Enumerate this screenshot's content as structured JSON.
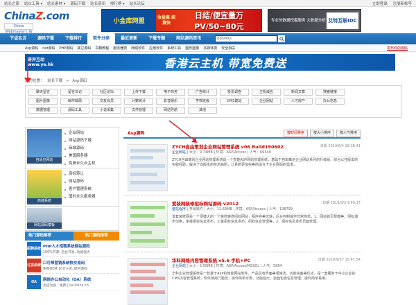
{
  "topbar": {
    "left": [
      "站长之家",
      "站长工具 ▾",
      "站长素材 ▾",
      "源码下载",
      "站长资讯",
      "排行榜 ▾",
      "站长论坛"
    ],
    "right": [
      "立即登录",
      "注册新帐号"
    ]
  },
  "header": {
    "logo_brand_a": "China",
    "logo_brand_z": "Z",
    "logo_brand_b": ".com",
    "logo_tag": "China Webmaster | 站长下载",
    "banner1_left": "小金库网盟",
    "banner1_mid": "收益高 结算快",
    "banner1_right": "日结/便宜量万PV/50~80元",
    "banner2_text": "专业的数据挖掘服务 大数据分析",
    "banner2_logo": "艾特互联IDC"
  },
  "nav": {
    "items": [
      {
        "label": "下载首页",
        "active": false
      },
      {
        "label": "源码下载",
        "active": false
      },
      {
        "label": "下载排行",
        "active": false
      },
      {
        "label": "软件分类",
        "active": true
      },
      {
        "label": "最近更新",
        "active": false
      },
      {
        "label": "下载专题",
        "active": false
      },
      {
        "label": "网站源码资讯",
        "active": false
      }
    ],
    "search_placeholder": "BBSMAX"
  },
  "subnav": {
    "items": [
      "Asp源码",
      "net源码",
      "PHP源码",
      "其它源码",
      "书籍教程",
      "服务器类",
      "网络软件",
      "应用软件",
      "系统工具",
      "图形图像",
      "多媒体类",
      "安全相关"
    ],
    "publish": "发布你的源码"
  },
  "bigbanner": {
    "brand": "奇异互动 www.ye.hk",
    "slogan": "香港云主机  带宽免费送"
  },
  "breadcrumb": [
    "您的位置：",
    "站长下载",
    ">",
    "Asp源码"
  ],
  "tags": [
    [
      "聊天留言",
      "留言日记",
      "社区论坛",
      "上传下载",
      "电子商务",
      "广告统计",
      "投票调查",
      "主机域名",
      "新闻文章",
      "搜索链接"
    ],
    [
      "图片图像",
      "邮件邮局",
      "交友会员",
      "计数统计",
      "影音娱乐",
      "学校班级",
      "CMS建站",
      "企业网站",
      "人才房产",
      "办公信息"
    ],
    [
      "数据管理",
      "源码工具",
      "小说采集",
      "文件管理",
      "网站导航",
      "其他"
    ]
  ],
  "left": {
    "sections": [
      {
        "caption": "自适应网站",
        "links": [
          "企业网站",
          "网站源码下载",
          "商城源码",
          "美国服务器",
          "免费永久云主机"
        ]
      },
      {
        "caption": "商城系统",
        "links": [
          "商标转让",
          "网站源码",
          "客户管理系统",
          "国外永久服务器"
        ]
      },
      {
        "caption": "网站源码模板",
        "links": []
      }
    ],
    "hot_tab": "热门源码推荐",
    "hot_tab2": "热门源码推荐",
    "hot_items": [
      {
        "icon": "招聘系统",
        "color": "#1b6fc0",
        "title": "PHP人才招聘系统网站源码",
        "desc": "100%开源, 后台开发, 功能强大"
      },
      {
        "icon": "订货系统",
        "color": "#d43a2a",
        "title": "口可帮营销系统快交易码",
        "desc": "免费OEM 10万+店, 提供源码"
      },
      {
        "icon": "OA",
        "color": "#1b6fc0",
        "title": "网络办公自动化（OA）系统",
        "desc": "无成功会 · 免费 | oa.ibilnu.cn"
      }
    ]
  },
  "right": {
    "section_title": "Asp源码",
    "sort_buttons": [
      {
        "label": "按时间排序",
        "on": true
      },
      {
        "label": "按大小排序",
        "on": false
      },
      {
        "label": "按人气排序",
        "on": false
      }
    ],
    "entries": [
      {
        "title": "ZYCH自由策划企业网站管理系统 v06 Build190602",
        "date": "日期 2019/6/4 18:38:41",
        "category": "企业网站",
        "meta": "| 大小：9.74MB | 环境：ASP/Access | 人气：69349",
        "desc": "ZYCH自由策划企业网站管理系统是一个智能ASP网站管理系统，基础于自由策划企业网站系列的升级版，综合以往版本的实践经验，解决了旧版本的技术缺陷，让系统更加完美的适合于企业网站的需求。"
      },
      {
        "title": "爱装网装修招标网站源码 v2012",
        "date": "日期 2019/9/3 9:49:17",
        "category": "整站程序",
        "meta": "| 开源软件 | 大小：11.63MB | 环境：ASP/Access | 人气：138799",
        "desc": "该套装修网是一个便捷大的一个装修装修招标网站，程序完美无缺，后台控制操作非常简单，1、网站首页规模等，招标城市切换，家装招标信息发布，工装招标信息发布，招标信息管理等，2、招标信息发布页面管理。"
      },
      {
        "title": "华科网络内容管理系统 v5.6 手机+PC",
        "date": "日期 2019/9/17 15:47:54",
        "category": "企业网站",
        "meta": "| 大小：5.95MB | 环境：ASP/Access/MSSQL | 人气：5884",
        "desc": "华科企业管理系统是一款基于ASP的智能网站软件，产品具有界面美观简洁、功能完备等优点，是一套服务于中小企业的CMS内容管理系统，软件使用门槛低，操作简单可靠，功能强大，全面包含信息管理、操作简单易用。"
      }
    ]
  },
  "colors": {
    "nav_blue": "#1c64ad",
    "accent_red": "#c00",
    "arrow": "#e02424"
  }
}
